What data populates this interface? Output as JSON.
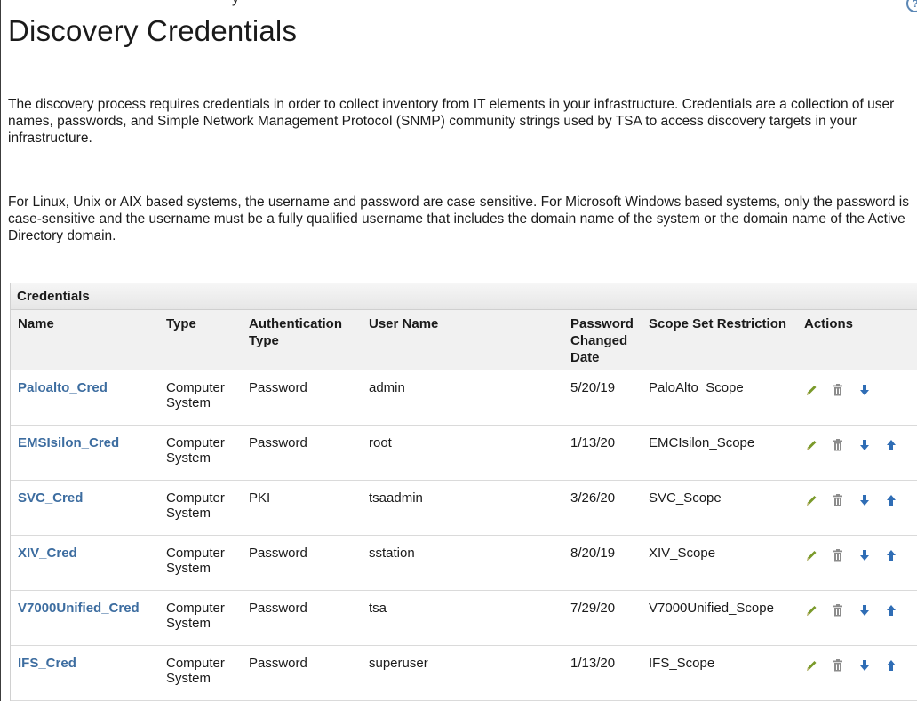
{
  "page": {
    "top_cutoff_text": "y",
    "title": "Discovery Credentials",
    "help_icon": "help-icon",
    "paragraphs": [
      "The discovery process requires credentials in order to collect inventory from IT elements in your infrastructure. Credentials are a collection of user names, passwords, and Simple Network Management Protocol (SNMP) community strings used by TSA to access discovery targets in your infrastructure.",
      "For Linux, Unix or AIX based systems, the username and password are case sensitive. For Microsoft Windows based systems, only the password is case-sensitive and the username must be a fully qualified username that includes the domain name of the system or the domain name of the Active Directory domain."
    ]
  },
  "credentials": {
    "panel_title": "Credentials",
    "columns": [
      "Name",
      "Type",
      "Authentication Type",
      "User Name",
      "Password Changed Date",
      "Scope Set Restriction",
      "Actions"
    ],
    "rows": [
      {
        "name": "Paloalto_Cred",
        "type": "Computer System",
        "auth": "Password",
        "user": "admin",
        "date": "5/20/19",
        "scope": "PaloAlto_Scope",
        "actions": [
          "edit-icon",
          "delete-icon",
          "move-down-icon"
        ]
      },
      {
        "name": "EMSIsilon_Cred",
        "type": "Computer System",
        "auth": "Password",
        "user": "root",
        "date": "1/13/20",
        "scope": "EMCIsilon_Scope",
        "actions": [
          "edit-icon",
          "delete-icon",
          "move-down-icon",
          "move-up-icon"
        ]
      },
      {
        "name": "SVC_Cred",
        "type": "Computer System",
        "auth": "PKI",
        "user": "tsaadmin",
        "date": "3/26/20",
        "scope": "SVC_Scope",
        "actions": [
          "edit-icon",
          "delete-icon",
          "move-down-icon",
          "move-up-icon"
        ]
      },
      {
        "name": "XIV_Cred",
        "type": "Computer System",
        "auth": "Password",
        "user": "sstation",
        "date": "8/20/19",
        "scope": "XIV_Scope",
        "actions": [
          "edit-icon",
          "delete-icon",
          "move-down-icon",
          "move-up-icon"
        ]
      },
      {
        "name": "V7000Unified_Cred",
        "type": "Computer System",
        "auth": "Password",
        "user": "tsa",
        "date": "7/29/20",
        "scope": "V7000Unified_Scope",
        "actions": [
          "edit-icon",
          "delete-icon",
          "move-down-icon",
          "move-up-icon"
        ]
      },
      {
        "name": "IFS_Cred",
        "type": "Computer System",
        "auth": "Password",
        "user": "superuser",
        "date": "1/13/20",
        "scope": "IFS_Scope",
        "actions": [
          "edit-icon",
          "delete-icon",
          "move-down-icon",
          "move-up-icon"
        ]
      }
    ]
  },
  "colors": {
    "link": "#3d6da0",
    "edit_icon": "#7a9a2a",
    "delete_icon": "#8c8c8c",
    "arrow_icon": "#2f6db5"
  }
}
